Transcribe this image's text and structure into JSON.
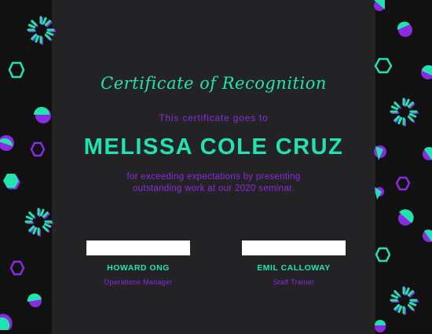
{
  "certificate": {
    "title": "Certificate of Recognition",
    "intro": "This certificate goes to",
    "recipient": "MELISSA COLE CRUZ",
    "reason_line1": "for exceeding expectations by presenting",
    "reason_line2": "outstanding work at our 2020 seminar.",
    "signatories": [
      {
        "name": "HOWARD ONG",
        "role": "Operations Manager"
      },
      {
        "name": "EMIL CALLOWAY",
        "role": "Staff Trainer"
      }
    ]
  },
  "colors": {
    "accent_teal": "#22e3b0",
    "accent_purple": "#8a2be2",
    "background": "#232325"
  }
}
